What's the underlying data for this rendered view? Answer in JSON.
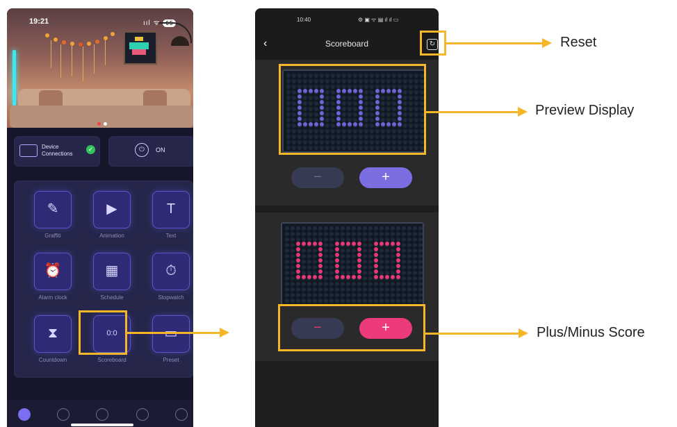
{
  "left_phone": {
    "status": {
      "time": "19:21",
      "signal": "ııl",
      "wifi": "ᯤ",
      "battery": "65"
    },
    "device_card": {
      "label_line1": "Device",
      "label_line2": "Connections"
    },
    "power_card": {
      "label": "ON"
    },
    "tiles": [
      {
        "name": "graffiti",
        "label": "Graffiti",
        "icon": "✎"
      },
      {
        "name": "animation",
        "label": "Animation",
        "icon": "▶"
      },
      {
        "name": "text",
        "label": "Text",
        "icon": "T"
      },
      {
        "name": "alarm-clock",
        "label": "Alarm clock",
        "icon": "⏰"
      },
      {
        "name": "schedule",
        "label": "Schedule",
        "icon": "▦"
      },
      {
        "name": "stopwatch",
        "label": "Stopwatch",
        "icon": "⏱"
      },
      {
        "name": "countdown",
        "label": "Countdown",
        "icon": "⧗"
      },
      {
        "name": "scoreboard",
        "label": "Scoreboard",
        "icon": "0:0"
      },
      {
        "name": "preset",
        "label": "Preset",
        "icon": "▭"
      }
    ]
  },
  "right_phone": {
    "status": {
      "time": "10:40",
      "icons": "⚙ ▣ ᯤ ▤ ıl ıl ▭"
    },
    "title": "Scoreboard",
    "back": "‹",
    "reset_glyph": "↻",
    "minus": "−",
    "plus": "+",
    "top_score": "000",
    "bottom_score": "000",
    "colors": {
      "top": "#6f63d9",
      "bottom": "#e43a78"
    }
  },
  "annotations": {
    "reset": "Reset",
    "preview": "Preview Display",
    "plus_minus": "Plus/Minus Score"
  }
}
